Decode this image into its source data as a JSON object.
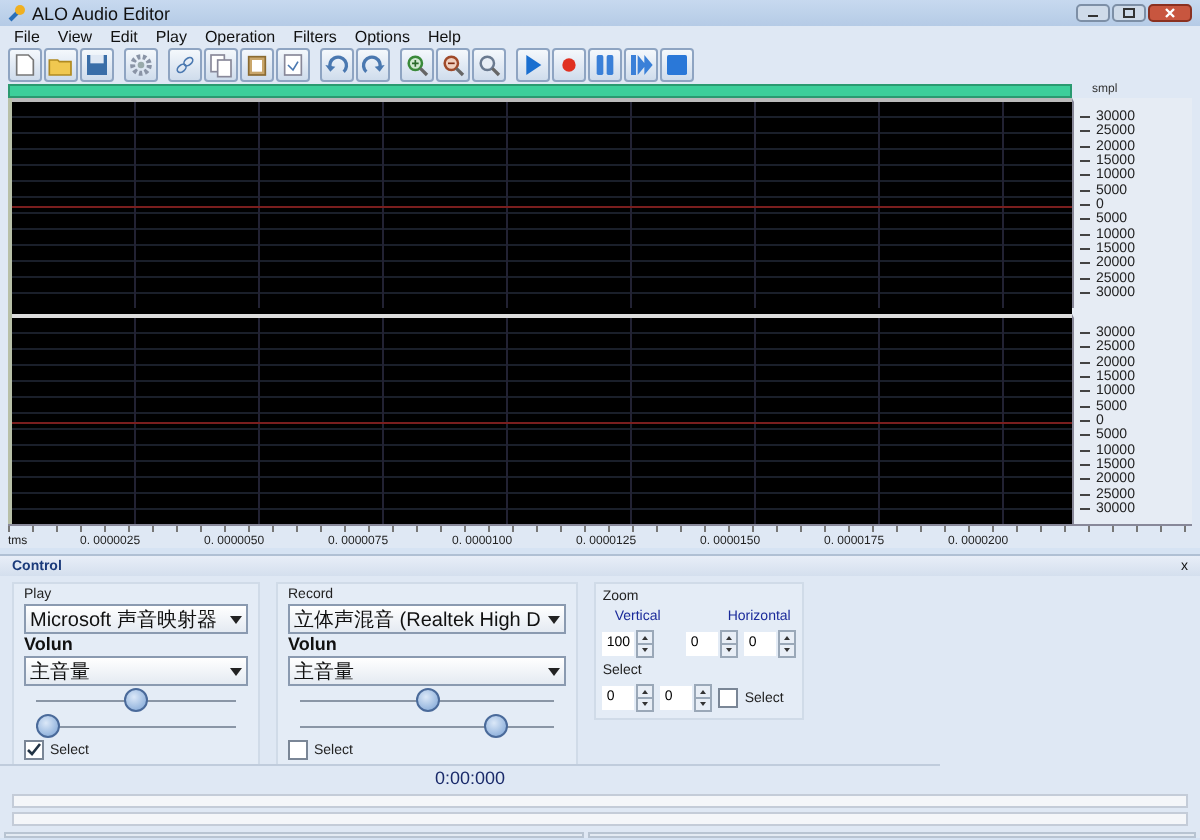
{
  "window": {
    "title": "ALO Audio Editor"
  },
  "menu": [
    "File",
    "View",
    "Edit",
    "Play",
    "Operation",
    "Filters",
    "Options",
    "Help"
  ],
  "waveform": {
    "axis_unit": "smpl",
    "channels": [
      {
        "axis_labels": [
          "30000",
          "25000",
          "20000",
          "15000",
          "10000",
          "5000",
          "0",
          "5000",
          "10000",
          "15000",
          "20000",
          "25000",
          "30000"
        ]
      },
      {
        "axis_labels": [
          "30000",
          "25000",
          "20000",
          "15000",
          "10000",
          "5000",
          "0",
          "5000",
          "10000",
          "15000",
          "20000",
          "25000",
          "30000"
        ]
      }
    ],
    "time_ruler": {
      "unit": "tms",
      "labels": [
        "0. 0000025",
        "0. 0000050",
        "0. 0000075",
        "0. 0000100",
        "0. 0000125",
        "0. 0000150",
        "0. 0000175",
        "0. 0000200"
      ]
    }
  },
  "control_panel": {
    "title": "Control",
    "close": "x",
    "play": {
      "title": "Play",
      "device": "Microsoft 声音映射器",
      "volume_label": "Volun",
      "source": "主音量",
      "sliders": [
        {
          "level": 0.5
        },
        {
          "level": 0
        }
      ],
      "select": {
        "label": "Select",
        "checked": true
      }
    },
    "record": {
      "title": "Record",
      "device": "立体声混音 (Realtek High D",
      "volume_label": "Volun",
      "source": "主音量",
      "sliders": [
        {
          "level": 0.5
        },
        {
          "level": 0.8
        }
      ],
      "select": {
        "label": "Select",
        "checked": false
      }
    },
    "zoom": {
      "title": "Zoom",
      "vertical_label": "Vertical",
      "horizontal_label": "Horizontal",
      "vertical": "100",
      "horizontal": [
        "0",
        "0"
      ],
      "select_title": "Select",
      "select_values": [
        "0",
        "0"
      ],
      "select": {
        "label": "Select",
        "checked": false
      }
    }
  },
  "time": "0:00:000"
}
